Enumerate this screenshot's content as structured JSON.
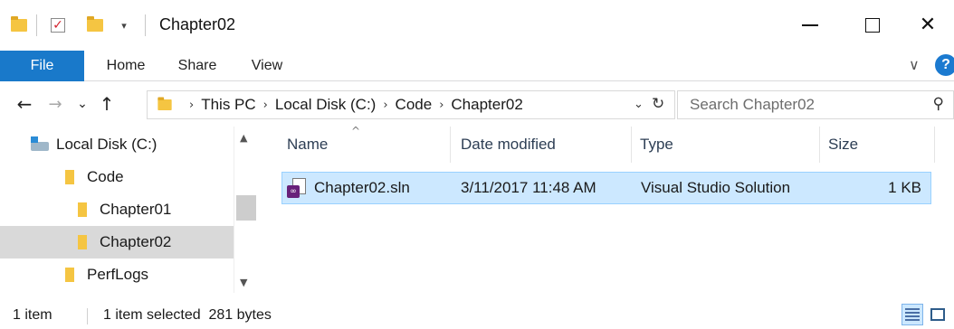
{
  "window": {
    "title": "Chapter02",
    "minimize_icon": "minimize-icon",
    "maximize_icon": "maximize-icon",
    "close_icon": "close-icon",
    "close_glyph": "✕"
  },
  "quick_access": {
    "check_glyph": "✓",
    "dropdown_glyph": "▾"
  },
  "ribbon": {
    "tabs": [
      "File",
      "Home",
      "Share",
      "View"
    ],
    "chevron_glyph": "∨",
    "help_glyph": "?"
  },
  "nav": {
    "back_glyph": "←",
    "forward_glyph": "→",
    "recent_glyph": "⌄",
    "up_glyph": "↑",
    "breadcrumb": [
      "This PC",
      "Local Disk (C:)",
      "Code",
      "Chapter02"
    ],
    "crumb_sep": "›",
    "address_dropdown_glyph": "⌄",
    "refresh_glyph": "↻",
    "search_placeholder": "Search Chapter02",
    "search_glyph": "⚲"
  },
  "nav_pane": {
    "items": [
      {
        "label": "Local Disk (C:)",
        "icon": "drive-icon",
        "selected": false
      },
      {
        "label": "Code",
        "icon": "folder-icon",
        "selected": false
      },
      {
        "label": "Chapter01",
        "icon": "folder-icon",
        "selected": false
      },
      {
        "label": "Chapter02",
        "icon": "folder-icon",
        "selected": true
      },
      {
        "label": "PerfLogs",
        "icon": "folder-icon",
        "selected": false
      }
    ],
    "scroll_up_glyph": "▲",
    "scroll_down_glyph": "▼"
  },
  "file_list": {
    "columns": [
      "Name",
      "Date modified",
      "Type",
      "Size"
    ],
    "sort_glyph": "^",
    "rows": [
      {
        "name": "Chapter02.sln",
        "date_modified": "3/11/2017 11:48 AM",
        "type": "Visual Studio Solution",
        "size": "1 KB",
        "icon": "visual-studio-solution-icon",
        "selected": true
      }
    ]
  },
  "status_bar": {
    "item_count": "1 item",
    "selection": "1 item selected  281 bytes"
  },
  "colors": {
    "accent": "#1979ca",
    "selection_bg": "#cce8ff",
    "selection_border": "#99d1ff",
    "tree_selected_bg": "#d9d9d9",
    "folder": "#f5c542"
  }
}
